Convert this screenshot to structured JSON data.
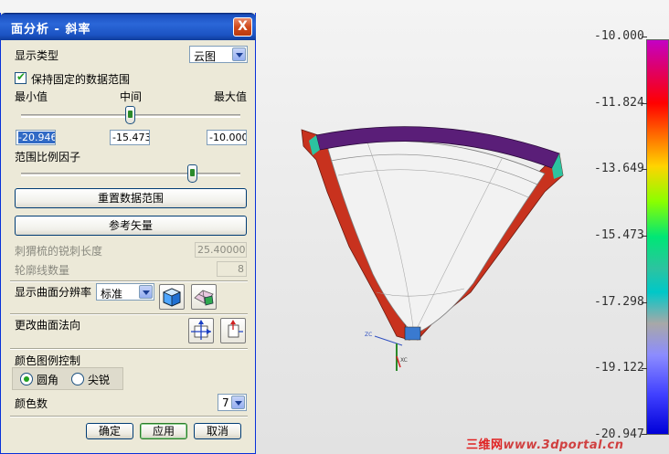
{
  "dialog": {
    "title": "面分析 - 斜率",
    "close_glyph": "X",
    "display_type_label": "显示类型",
    "display_type_value": "云图",
    "keep_range_label": "保持固定的数据范围",
    "keep_range_checked": true,
    "min_label": "最小值",
    "mid_label": "中间",
    "max_label": "最大值",
    "min_value": "-20.946",
    "mid_value": "-15.473",
    "max_value": "-10.000",
    "range_scale_label": "范围比例因子",
    "reset_range_button": "重置数据范围",
    "reference_vector_button": "参考矢量",
    "spike_length_label": "刺猬梳的锐刺长度",
    "spike_length_value": "25.40000",
    "contour_count_label": "轮廓线数量",
    "contour_count_value": "8",
    "surface_resolution_label": "显示曲面分辨率",
    "surface_resolution_value": "标准",
    "change_normal_label": "更改曲面法向",
    "legend_control_label": "颜色图例控制",
    "radio_round": "圆角",
    "radio_sharp": "尖锐",
    "color_count_label": "颜色数",
    "color_count_value": "7",
    "ok_button": "确定",
    "apply_button": "应用",
    "cancel_button": "取消"
  },
  "legend": {
    "ticks": [
      "-10.000",
      "-11.824",
      "-13.649",
      "-15.473",
      "-17.298",
      "-19.122",
      "-20.947"
    ]
  },
  "viewport": {
    "axis_zc": "ZC",
    "axis_xc": "XC"
  },
  "watermark": {
    "brand": "三维网",
    "site": "www.3dportal.cn"
  },
  "colors": {
    "title_bar": "#1c54c4",
    "dialog_bg": "#ece9d8",
    "model_red": "#c8321e",
    "model_rim": "#5a1e78",
    "watermark": "#e02020"
  }
}
